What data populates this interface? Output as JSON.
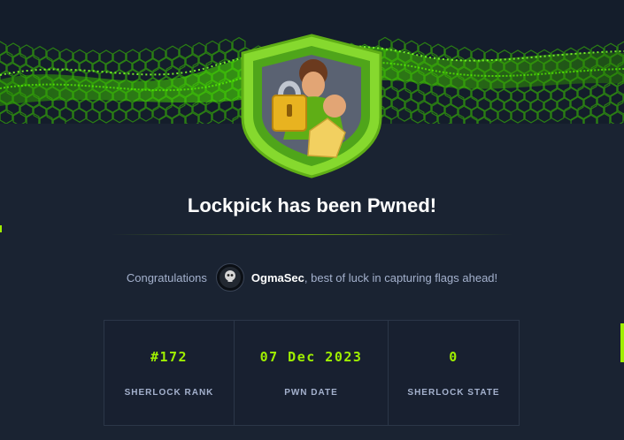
{
  "colors": {
    "accent": "#9fef00",
    "background": "#141d2b",
    "card": "#1a2332",
    "muted_text": "#a4b1cd"
  },
  "badge": {
    "icon": "lockpick-badge-icon"
  },
  "title": "Lockpick has been Pwned!",
  "congrats": {
    "prefix": "Congratulations",
    "username": "OgmaSec",
    "suffix": ", best of luck in capturing flags ahead!"
  },
  "stats": [
    {
      "value": "#172",
      "label": "SHERLOCK RANK"
    },
    {
      "value": "07 Dec 2023",
      "label": "PWN DATE"
    },
    {
      "value": "0",
      "label": "SHERLOCK STATE"
    }
  ]
}
